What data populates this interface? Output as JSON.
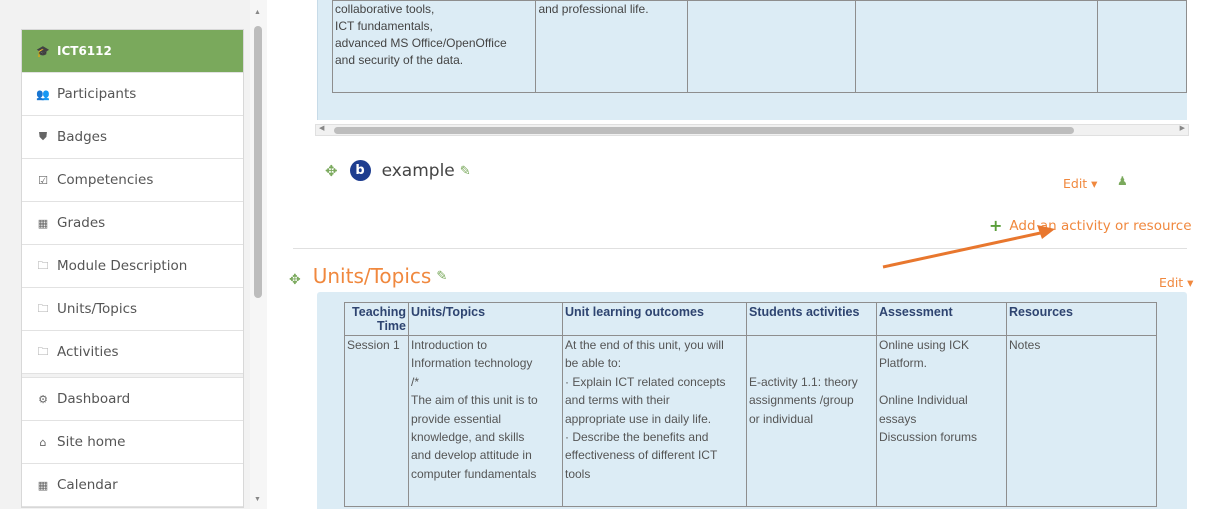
{
  "sidebar": {
    "items": [
      {
        "label": "ICT6112",
        "icon": "graduation-cap-icon",
        "glyph": "🎓",
        "active": true
      },
      {
        "label": "Participants",
        "icon": "users-icon",
        "glyph": "👥"
      },
      {
        "label": "Badges",
        "icon": "shield-icon",
        "glyph": "⛊"
      },
      {
        "label": "Competencies",
        "icon": "check-square-icon",
        "glyph": "☑"
      },
      {
        "label": "Grades",
        "icon": "table-icon",
        "glyph": "▦"
      },
      {
        "label": "Module Description",
        "icon": "folder-icon",
        "glyph": "🗀"
      },
      {
        "label": "Units/Topics",
        "icon": "folder-icon",
        "glyph": "🗀"
      },
      {
        "label": "Activities",
        "icon": "folder-icon",
        "glyph": "🗀"
      },
      {
        "label": "Dashboard",
        "icon": "dashboard-icon",
        "glyph": "⚙"
      },
      {
        "label": "Site home",
        "icon": "home-icon",
        "glyph": "⌂"
      },
      {
        "label": "Calendar",
        "icon": "calendar-icon",
        "glyph": "▦"
      }
    ]
  },
  "top_table": {
    "col1": [
      "collaborative tools,",
      "ICT fundamentals,",
      "advanced MS Office/OpenOffice",
      "and security of the data."
    ],
    "col2": [
      "and professional life."
    ]
  },
  "activity": {
    "name": "example",
    "edit_label": "Edit ▾",
    "add_label": "Add an activity or resource"
  },
  "section": {
    "title": "Units/Topics",
    "edit_label": "Edit ▾"
  },
  "unit_table": {
    "headers": [
      "Teaching Time",
      "Units/Topics",
      "Unit learning outcomes",
      "Students activities",
      "Assessment",
      "Resources"
    ],
    "row": {
      "time": [
        "Session 1"
      ],
      "topics": [
        "Introduction to",
        "Information technology",
        "/*",
        "The aim of this unit is to",
        "provide essential",
        "knowledge, and skills",
        "and develop attitude in",
        "computer fundamentals"
      ],
      "outcomes": [
        "At the end of this unit, you will",
        "be able to:",
        "·   Explain ICT related concepts",
        "and terms with their",
        "appropriate use in daily life.",
        "·   Describe the benefits and",
        "effectiveness of different ICT",
        "tools"
      ],
      "activities": [
        "",
        "",
        "E-activity 1.1: theory",
        "assignments /group",
        "or individual"
      ],
      "assessment": [
        "Online using ICK",
        "Platform.",
        "",
        "Online Individual",
        "essays",
        "Discussion forums"
      ],
      "resources": [
        "Notes"
      ]
    }
  },
  "colors": {
    "accent_green": "#7aa95c",
    "link_orange": "#f0883e",
    "box_blue": "#dcecf5"
  }
}
